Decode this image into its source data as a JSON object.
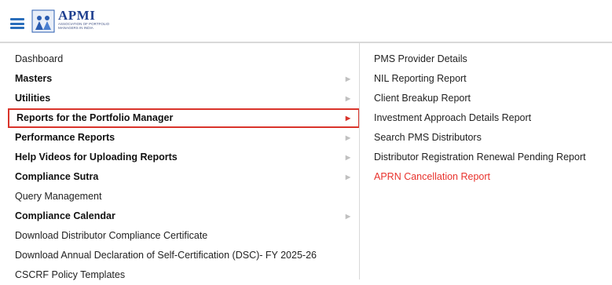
{
  "header": {
    "logo_title": "APMI",
    "logo_subtitle": "Association of Portfolio Managers in India"
  },
  "menu": {
    "items": [
      {
        "label": "Dashboard"
      },
      {
        "label": "Masters"
      },
      {
        "label": "Utilities"
      },
      {
        "label": "Reports for the Portfolio Manager"
      },
      {
        "label": "Performance Reports"
      },
      {
        "label": "Help Videos for Uploading Reports"
      },
      {
        "label": "Compliance Sutra"
      },
      {
        "label": "Query Management"
      },
      {
        "label": "Compliance Calendar"
      },
      {
        "label": "Download Distributor Compliance Certificate"
      },
      {
        "label": "Download Annual Declaration of Self-Certification (DSC)- FY 2025-26"
      },
      {
        "label": "CSCRF Policy Templates"
      }
    ],
    "active_item": "Reports for the Portfolio Manager"
  },
  "submenu": {
    "items": [
      {
        "label": "PMS Provider Details"
      },
      {
        "label": "NIL Reporting Report"
      },
      {
        "label": "Client Breakup Report"
      },
      {
        "label": "Investment Approach Details Report"
      },
      {
        "label": "Search PMS Distributors"
      },
      {
        "label": "Distributor Registration Renewal Pending Report"
      },
      {
        "label": "APRN Cancellation Report"
      }
    ],
    "highlighted_item": "APRN Cancellation Report"
  },
  "colors": {
    "accent_blue": "#2a6ebb",
    "logo_blue": "#1f3f8f",
    "active_border": "#d9342b",
    "highlight_text": "#e8322c"
  },
  "icons": {
    "menu_toggle": "hamburger-icon",
    "submenu_arrow": "caret-right-icon"
  }
}
